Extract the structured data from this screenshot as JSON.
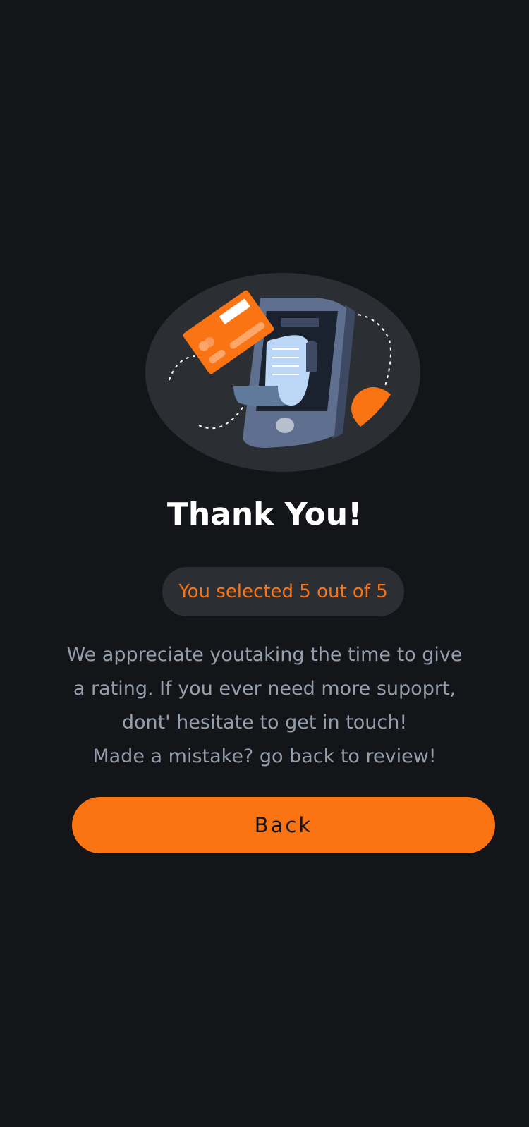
{
  "thank_you": {
    "title": "Thank You!",
    "selection_badge": "You selected 5 out of 5",
    "message_lines": [
      "We appreciate youtaking the time to give",
      "a rating. If you ever need more supoprt,",
      "dont' hesitate to get in touch!",
      "Made a mistake? go back to review!"
    ],
    "back_button_label": "Back"
  },
  "illustration": {
    "name": "phone-payment-illustration",
    "colors": {
      "background_ellipse": "#2b2e33",
      "accent": "#fb7413",
      "phone_body": "#5f6f8f",
      "phone_screen": "#1a2230",
      "receipt": "#bcd6f5"
    }
  },
  "colors": {
    "page_background": "#131518",
    "accent": "#fb7413",
    "title_text": "#ffffff",
    "body_text": "#959eac",
    "badge_background": "#2b2e33"
  }
}
